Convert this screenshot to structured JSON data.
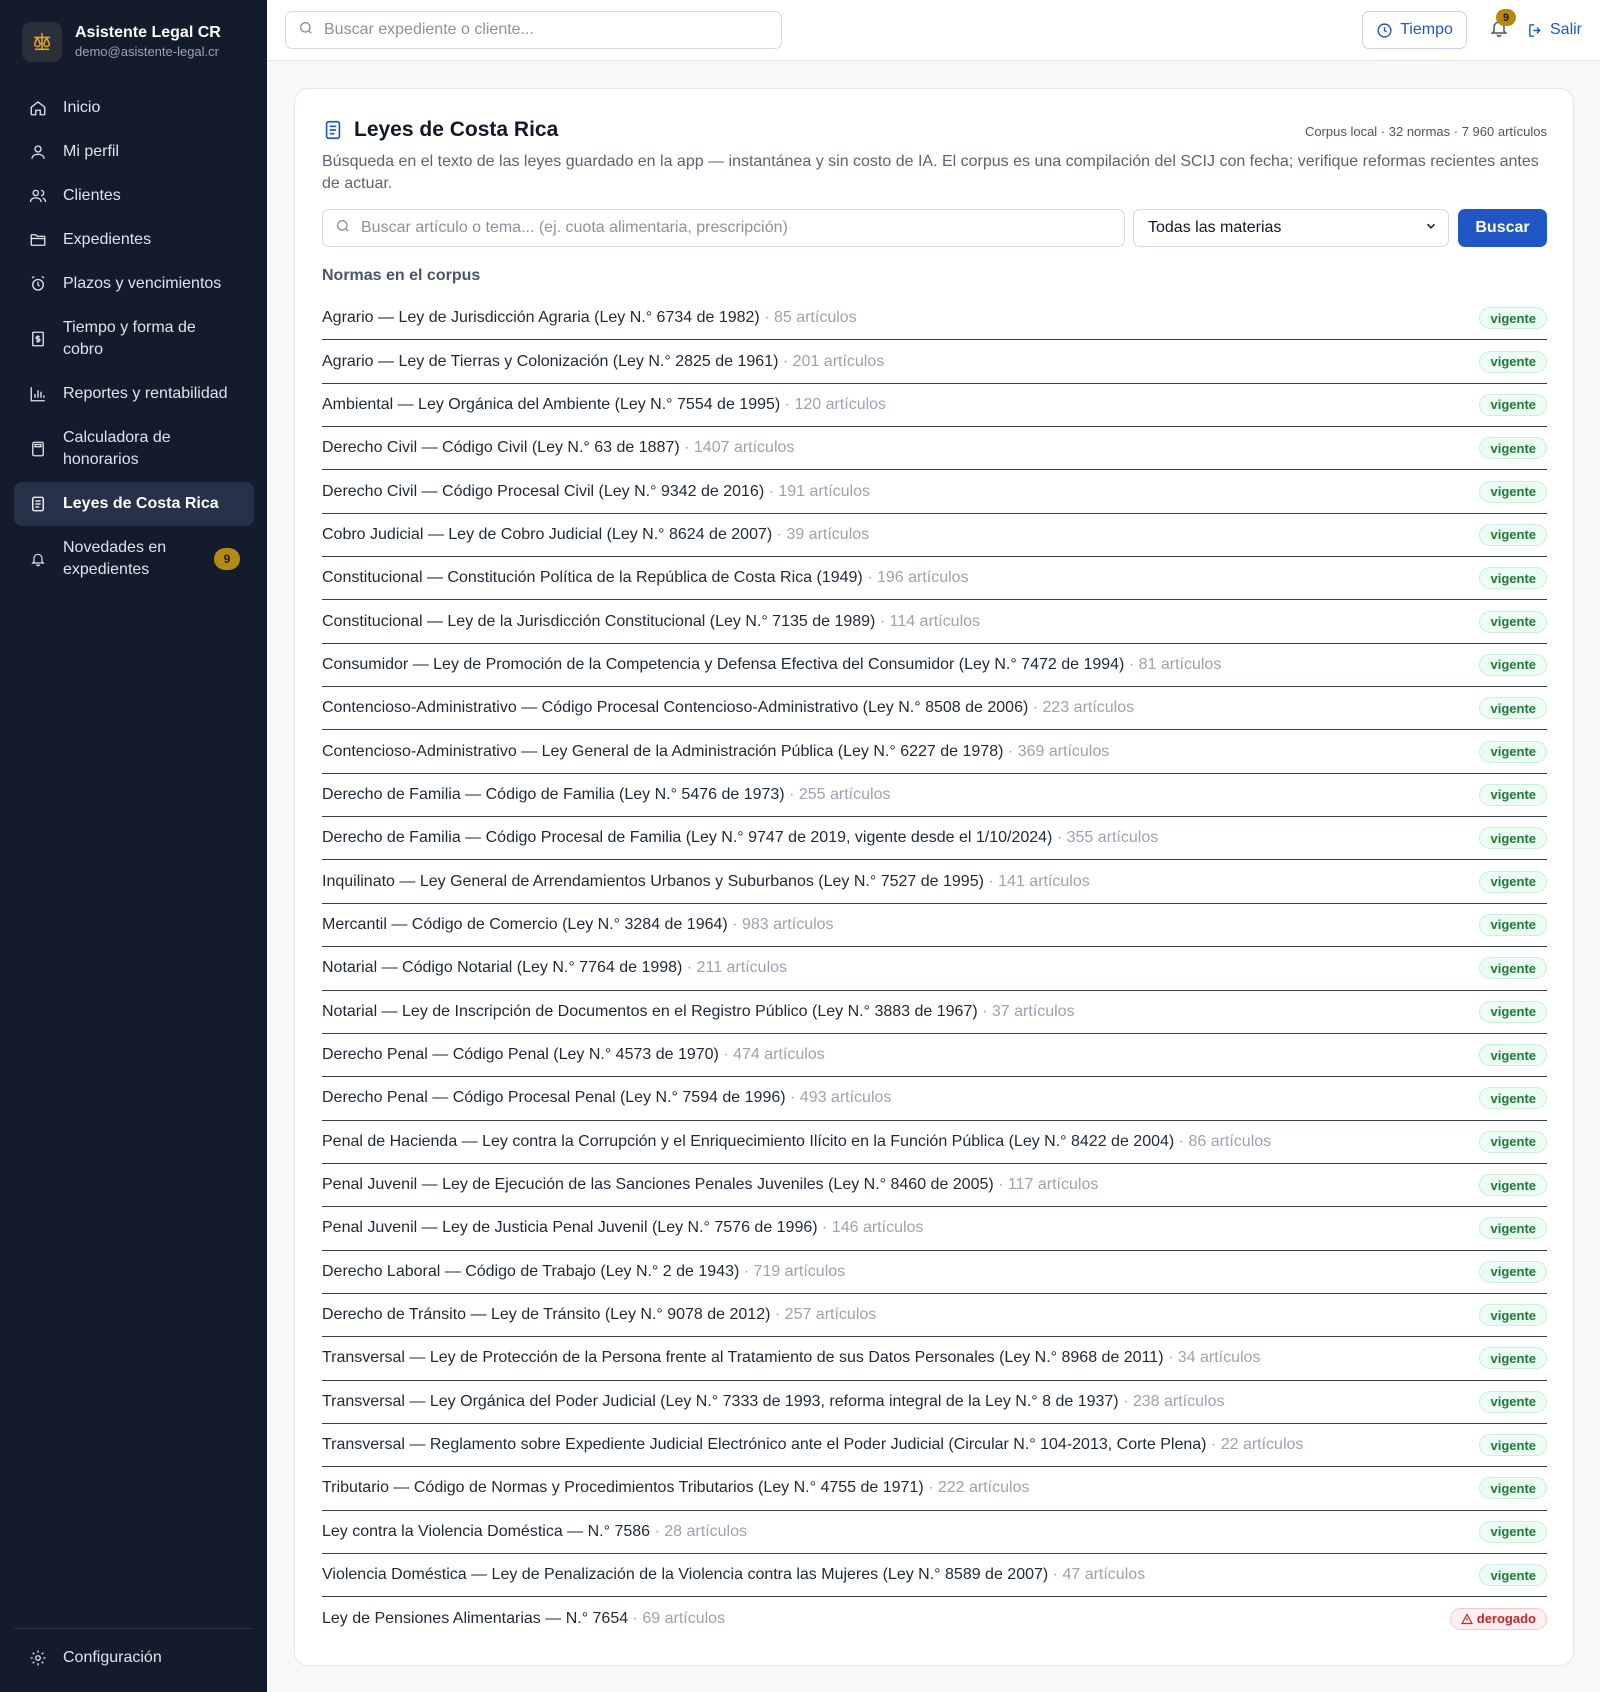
{
  "app": {
    "name": "Asistente Legal CR",
    "email": "demo@asistente-legal.cr"
  },
  "sidebar": {
    "items": [
      {
        "label": "Inicio",
        "icon": "home-icon"
      },
      {
        "label": "Mi perfil",
        "icon": "user-icon"
      },
      {
        "label": "Clientes",
        "icon": "users-icon"
      },
      {
        "label": "Expedientes",
        "icon": "folder-icon"
      },
      {
        "label": "Plazos y vencimientos",
        "icon": "alarm-icon"
      },
      {
        "label": "Tiempo y forma de cobro",
        "icon": "receipt-icon"
      },
      {
        "label": "Reportes y rentabilidad",
        "icon": "bar-chart-icon"
      },
      {
        "label": "Calculadora de honorarios",
        "icon": "calculator-icon"
      },
      {
        "label": "Leyes de Costa Rica",
        "icon": "document-icon",
        "active": true
      },
      {
        "label": "Novedades en expedientes",
        "icon": "bell-icon",
        "badge": "9"
      }
    ],
    "config_label": "Configuración"
  },
  "topbar": {
    "search_placeholder": "Buscar expediente o cliente...",
    "time_label": "Tiempo",
    "notifications_count": "9",
    "logout_label": "Salir"
  },
  "main": {
    "title": "Leyes de Costa Rica",
    "corpus_info": "Corpus local · 32 normas · 7 960 artículos",
    "description": "Búsqueda en el texto de las leyes guardado en la app — instantánea y sin costo de IA. El corpus es una compilación del SCIJ con fecha; verifique reformas recientes antes de actuar.",
    "search_placeholder": "Buscar artículo o tema... (ej. cuota alimentaria, prescripción)",
    "materia_selected": "Todas las materias",
    "search_button": "Buscar",
    "list_heading": "Normas en el corpus",
    "laws": [
      {
        "name": "Agrario — Ley de Jurisdicción Agraria (Ley N.° 6734 de 1982)",
        "count": "· 85 artículos",
        "status": "vigente"
      },
      {
        "name": "Agrario — Ley de Tierras y Colonización (Ley N.° 2825 de 1961)",
        "count": "· 201 artículos",
        "status": "vigente"
      },
      {
        "name": "Ambiental — Ley Orgánica del Ambiente (Ley N.° 7554 de 1995)",
        "count": "· 120 artículos",
        "status": "vigente"
      },
      {
        "name": "Derecho Civil — Código Civil (Ley N.° 63 de 1887)",
        "count": "· 1407 artículos",
        "status": "vigente"
      },
      {
        "name": "Derecho Civil — Código Procesal Civil (Ley N.° 9342 de 2016)",
        "count": "· 191 artículos",
        "status": "vigente"
      },
      {
        "name": "Cobro Judicial — Ley de Cobro Judicial (Ley N.° 8624 de 2007)",
        "count": "· 39 artículos",
        "status": "vigente"
      },
      {
        "name": "Constitucional — Constitución Política de la República de Costa Rica (1949)",
        "count": "· 196 artículos",
        "status": "vigente"
      },
      {
        "name": "Constitucional — Ley de la Jurisdicción Constitucional (Ley N.° 7135 de 1989)",
        "count": "· 114 artículos",
        "status": "vigente"
      },
      {
        "name": "Consumidor — Ley de Promoción de la Competencia y Defensa Efectiva del Consumidor (Ley N.° 7472 de 1994)",
        "count": "· 81 artículos",
        "status": "vigente"
      },
      {
        "name": "Contencioso-Administrativo — Código Procesal Contencioso-Administrativo (Ley N.° 8508 de 2006)",
        "count": "· 223 artículos",
        "status": "vigente"
      },
      {
        "name": "Contencioso-Administrativo — Ley General de la Administración Pública (Ley N.° 6227 de 1978)",
        "count": "· 369 artículos",
        "status": "vigente"
      },
      {
        "name": "Derecho de Familia — Código de Familia (Ley N.° 5476 de 1973)",
        "count": "· 255 artículos",
        "status": "vigente"
      },
      {
        "name": "Derecho de Familia — Código Procesal de Familia (Ley N.° 9747 de 2019, vigente desde el 1/10/2024)",
        "count": "· 355 artículos",
        "status": "vigente"
      },
      {
        "name": "Inquilinato — Ley General de Arrendamientos Urbanos y Suburbanos (Ley N.° 7527 de 1995)",
        "count": "· 141 artículos",
        "status": "vigente"
      },
      {
        "name": "Mercantil — Código de Comercio (Ley N.° 3284 de 1964)",
        "count": "· 983 artículos",
        "status": "vigente"
      },
      {
        "name": "Notarial — Código Notarial (Ley N.° 7764 de 1998)",
        "count": "· 211 artículos",
        "status": "vigente"
      },
      {
        "name": "Notarial — Ley de Inscripción de Documentos en el Registro Público (Ley N.° 3883 de 1967)",
        "count": "· 37 artículos",
        "status": "vigente"
      },
      {
        "name": "Derecho Penal — Código Penal (Ley N.° 4573 de 1970)",
        "count": "· 474 artículos",
        "status": "vigente"
      },
      {
        "name": "Derecho Penal — Código Procesal Penal (Ley N.° 7594 de 1996)",
        "count": "· 493 artículos",
        "status": "vigente"
      },
      {
        "name": "Penal de Hacienda — Ley contra la Corrupción y el Enriquecimiento Ilícito en la Función Pública (Ley N.° 8422 de 2004)",
        "count": "· 86 artículos",
        "status": "vigente"
      },
      {
        "name": "Penal Juvenil — Ley de Ejecución de las Sanciones Penales Juveniles (Ley N.° 8460 de 2005)",
        "count": "· 117 artículos",
        "status": "vigente"
      },
      {
        "name": "Penal Juvenil — Ley de Justicia Penal Juvenil (Ley N.° 7576 de 1996)",
        "count": "· 146 artículos",
        "status": "vigente"
      },
      {
        "name": "Derecho Laboral — Código de Trabajo (Ley N.° 2 de 1943)",
        "count": "· 719 artículos",
        "status": "vigente"
      },
      {
        "name": "Derecho de Tránsito — Ley de Tránsito (Ley N.° 9078 de 2012)",
        "count": "· 257 artículos",
        "status": "vigente"
      },
      {
        "name": "Transversal — Ley de Protección de la Persona frente al Tratamiento de sus Datos Personales (Ley N.° 8968 de 2011)",
        "count": "· 34 artículos",
        "status": "vigente"
      },
      {
        "name": "Transversal — Ley Orgánica del Poder Judicial (Ley N.° 7333 de 1993, reforma integral de la Ley N.° 8 de 1937)",
        "count": "· 238 artículos",
        "status": "vigente"
      },
      {
        "name": "Transversal — Reglamento sobre Expediente Judicial Electrónico ante el Poder Judicial (Circular N.° 104-2013, Corte Plena)",
        "count": "· 22 artículos",
        "status": "vigente"
      },
      {
        "name": "Tributario — Código de Normas y Procedimientos Tributarios (Ley N.° 4755 de 1971)",
        "count": "· 222 artículos",
        "status": "vigente"
      },
      {
        "name": "Ley contra la Violencia Doméstica — N.° 7586",
        "count": "· 28 artículos",
        "status": "vigente"
      },
      {
        "name": "Violencia Doméstica — Ley de Penalización de la Violencia contra las Mujeres (Ley N.° 8589 de 2007)",
        "count": "· 47 artículos",
        "status": "vigente"
      },
      {
        "name": "Ley de Pensiones Alimentarias — N.° 7654",
        "count": "· 69 artículos",
        "status": "derogado"
      }
    ]
  },
  "colors": {
    "sidebar_bg": "#131c2c",
    "accent": "#2157c5",
    "badge_gold": "#b58a12",
    "vigente": "#1f7a3a",
    "derogado": "#c0262d"
  }
}
